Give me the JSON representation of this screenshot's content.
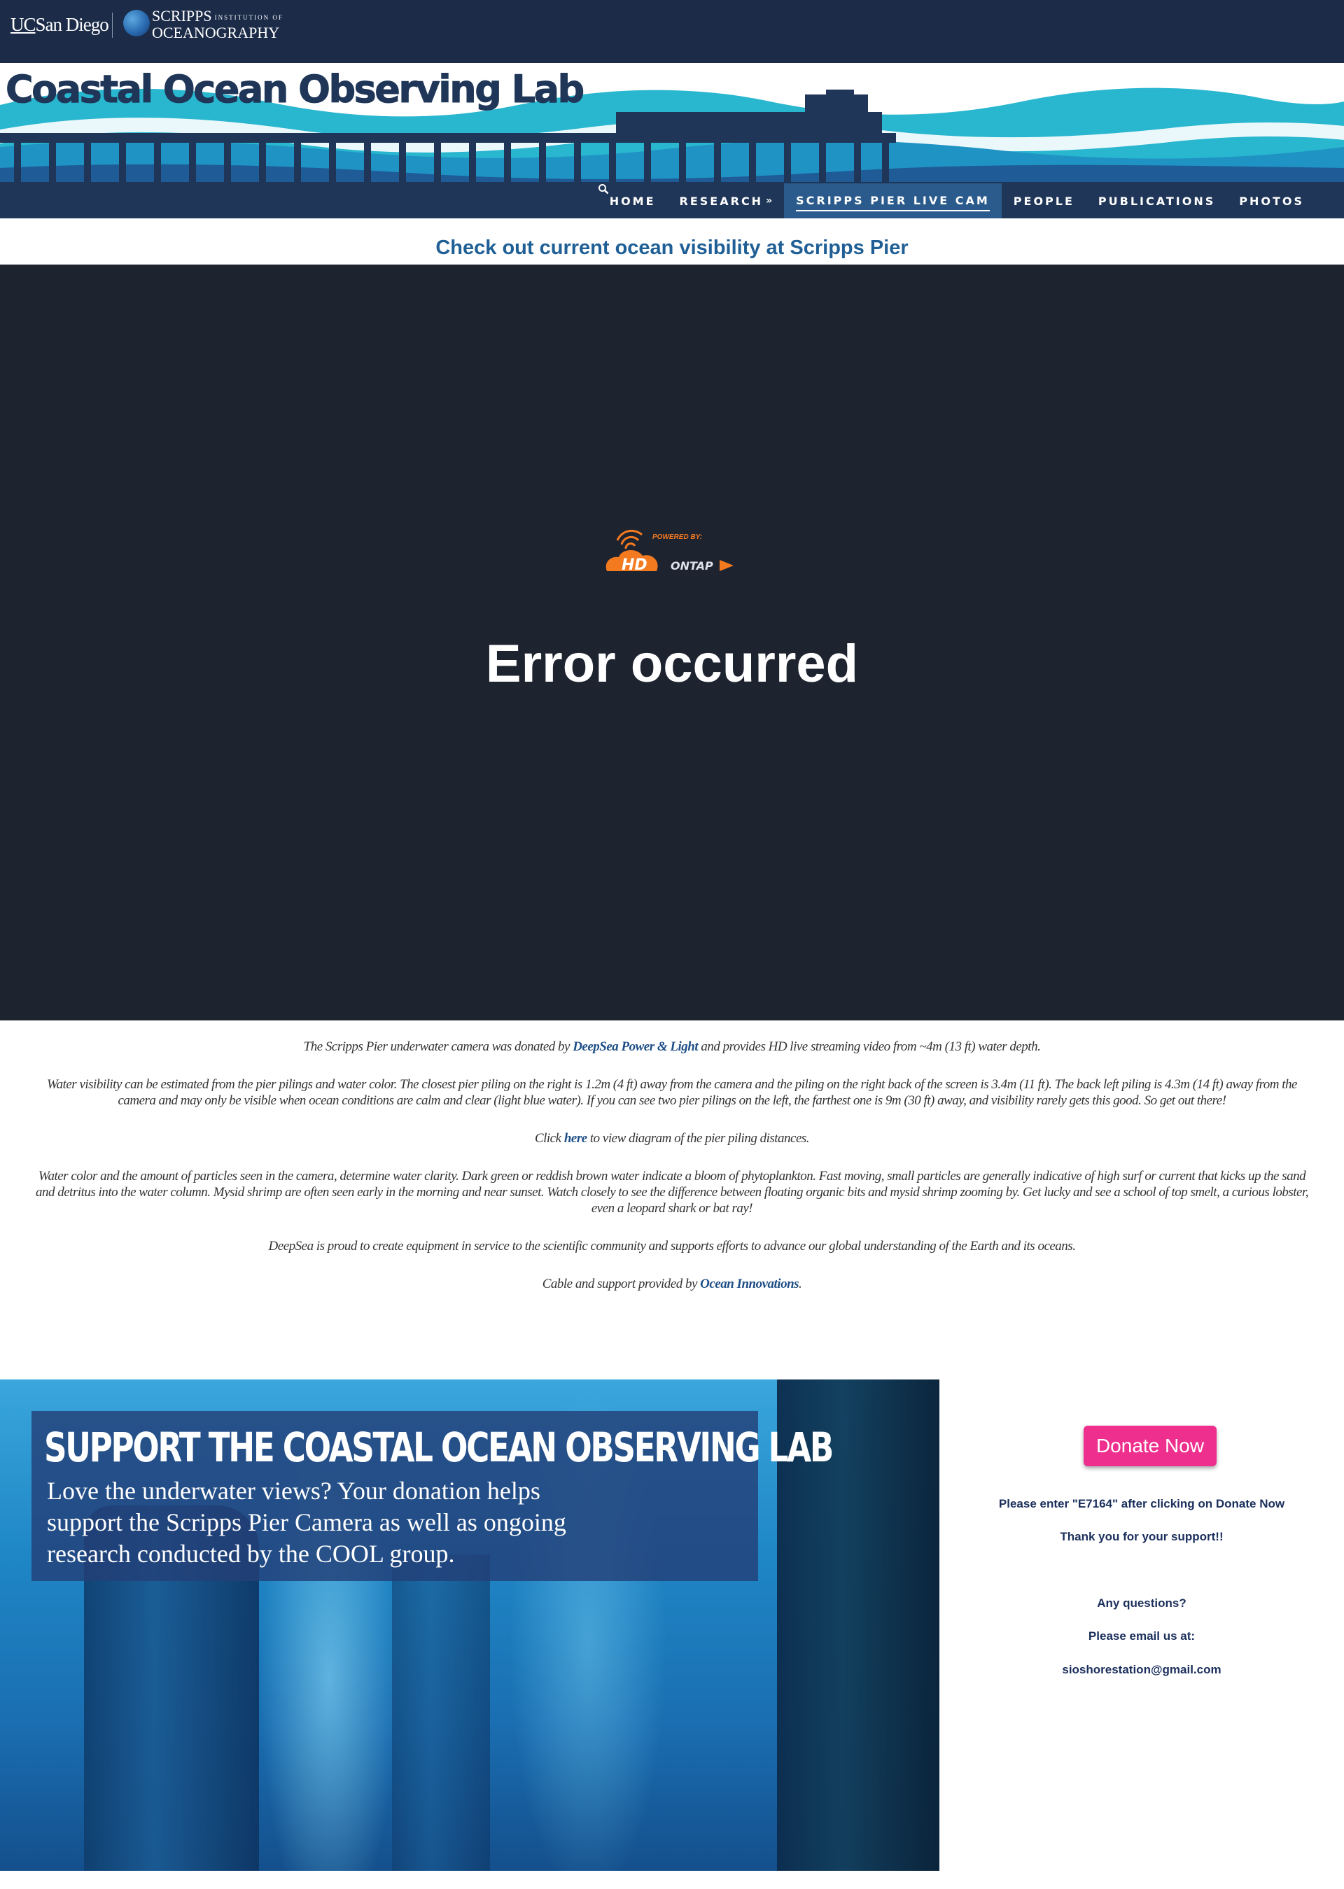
{
  "header": {
    "ucsd_logo": {
      "uc": "UC",
      "rest": "San Diego"
    },
    "scripps_logo": {
      "line1": "SCRIPPS",
      "line1_small": "INSTITUTION OF",
      "line2": "OCEANOGRAPHY"
    },
    "site_title": "Coastal Ocean Observing Lab"
  },
  "nav": {
    "items": [
      {
        "label": "HOME"
      },
      {
        "label": "RESEARCH",
        "has_dropdown": true
      },
      {
        "label": "SCRIPPS PIER LIVE CAM",
        "active": true
      },
      {
        "label": "PEOPLE"
      },
      {
        "label": "PUBLICATIONS"
      },
      {
        "label": "PHOTOS"
      }
    ],
    "search_icon": "search-icon"
  },
  "main": {
    "heading": "Check out current ocean visibility at Scripps Pier",
    "video": {
      "powered_by": "POWERED BY:",
      "brand_hd": "HD",
      "brand_ontap": "ONTAP",
      "error_message": "Error occurred"
    },
    "description": {
      "p1_pre": "The Scripps Pier underwater camera was donated by ",
      "p1_link": "DeepSea Power & Light",
      "p1_post": " and provides HD live streaming video from ~4m (13 ft) water depth.",
      "p2": "Water visibility can be estimated  from the pier pilings and water color. The closest  pier piling on the right is  1.2m (4 ft)  away from the camera and the piling on the right back of the screen is 3.4m (11 ft). The back left piling is 4.3m (14 ft) away from the camera and  may only be visible when ocean conditions are calm and clear (light blue water).  If you can  see two pier pilings on the left, the farthest one  is 9m (30 ft) away, and visibility rarely gets this good. So get out there!",
      "p3_pre": "Click ",
      "p3_link": "here",
      "p3_post": " to view diagram of the pier piling distances.",
      "p4": "Water color and the amount of particles seen in the camera, determine water clarity. Dark green or reddish  brown water indicate a bloom of phytoplankton. Fast moving, small particles are generally indicative of high surf or current that kicks up the sand  and detritus into the water column. Mysid shrimp are often seen early in the morning and near sunset. Watch closely to see the difference between floating organic bits and mysid shrimp zooming by. Get lucky and see a school of top smelt, a curious lobster, even a leopard shark or bat ray!",
      "p5": "DeepSea is proud to create equipment in service to the scientific community and supports efforts to advance our global understanding of the Earth and its oceans.",
      "p6_pre": "Cable and support provided by ",
      "p6_link": "Ocean Innovations",
      "p6_post": "."
    }
  },
  "donate": {
    "panel_title": "SUPPORT THE COASTAL OCEAN OBSERVING LAB",
    "panel_text": "Love the underwater views? Your donation helps support the Scripps Pier Camera as well as ongoing research conducted by the COOL group.",
    "button_label": "Donate Now",
    "instruction": "Please enter \"E7164\"  after clicking on Donate Now",
    "thanks": "Thank you for your support!!",
    "questions": "Any questions?",
    "email_prompt": "Please email us at:",
    "email": "sioshorestation@gmail.com"
  },
  "colors": {
    "top_bar": "#1b2b48",
    "banner_dark": "#1f3658",
    "wave_light": "#29b6cf",
    "nav_active": "#2a5b8c",
    "heading": "#1f5f95",
    "video_bg": "#1e2330",
    "link": "#1f4f86",
    "donate_button": "#ee2f8e",
    "side_text": "#1b2f5c"
  }
}
